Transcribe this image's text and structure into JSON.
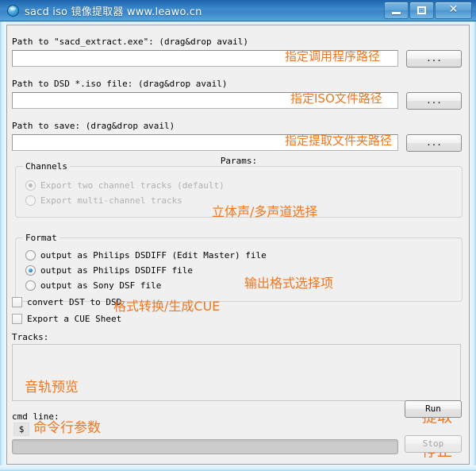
{
  "window": {
    "title": "sacd iso 镜像提取器  www.leawo.cn",
    "icon": "globe-icon",
    "buttons": {
      "minimize": "minimize-icon",
      "maximize": "maximize-icon",
      "close": "✕"
    }
  },
  "fields": {
    "exe_path": {
      "label": "Path to \"sacd_extract.exe\": (drag&drop avail)",
      "value": "",
      "browse_label": "...",
      "annotation": "指定调用程序路径"
    },
    "iso_path": {
      "label": "Path to DSD *.iso file: (drag&drop avail)",
      "value": "",
      "browse_label": "...",
      "annotation": "指定ISO文件路径"
    },
    "save_path": {
      "label": "Path to save: (drag&drop avail)",
      "value": "",
      "browse_label": "...",
      "annotation": "指定提取文件夹路径"
    }
  },
  "params_label": "Params:",
  "channels": {
    "legend": "Channels",
    "annotation": "立体声/多声道选择",
    "options": [
      {
        "label": "Export two channel tracks (default)",
        "checked": true,
        "disabled": true
      },
      {
        "label": "Export multi-channel tracks",
        "checked": false,
        "disabled": true
      }
    ]
  },
  "format": {
    "legend": "Format",
    "annotation": "输出格式选择项",
    "options": [
      {
        "label": "output as Philips DSDIFF (Edit Master) file",
        "checked": false,
        "disabled": false
      },
      {
        "label": "output as Philips DSDIFF file",
        "checked": true,
        "disabled": false
      },
      {
        "label": "output as Sony DSF file",
        "checked": false,
        "disabled": false
      }
    ]
  },
  "checkboxes": {
    "annotation": "格式转换/生成CUE",
    "items": [
      {
        "label": "convert DST to DSD",
        "checked": false
      },
      {
        "label": "Export a CUE Sheet",
        "checked": false
      }
    ]
  },
  "tracks": {
    "label": "Tracks:",
    "annotation": "音轨预览",
    "items": []
  },
  "actions": {
    "run_label": "Run",
    "run_annotation": "提取",
    "stop_label": "Stop",
    "stop_annotation": "停止",
    "stop_disabled": true
  },
  "cmdline": {
    "label": "cmd line:",
    "prompt": "$",
    "value": "",
    "annotation": "命令行参数"
  },
  "colors": {
    "annotation_orange": "#F0761F",
    "titlebar_blue": "#3d8bcc",
    "client_bg": "#f0f0f0"
  }
}
